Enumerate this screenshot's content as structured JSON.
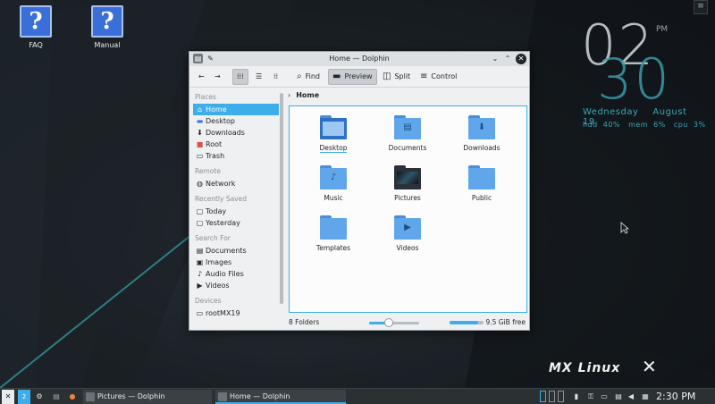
{
  "desktop": {
    "icons": [
      {
        "label": "FAQ",
        "glyph": "?"
      },
      {
        "label": "Manual",
        "glyph": "?"
      }
    ],
    "corner_button_glyph": "≡",
    "clock_widget": {
      "hour": "02",
      "minute": "30",
      "ampm": "PM",
      "day": "Wednesday",
      "date": "August 19",
      "stats": {
        "hdd_label": "hdd",
        "hdd_value": "40%",
        "mem_label": "mem",
        "mem_value": "6%",
        "cpu_label": "cpu",
        "cpu_value": "3%"
      }
    },
    "logo_text": "MX Linux"
  },
  "window": {
    "title": "Home — Dolphin",
    "toolbar": {
      "find": "Find",
      "preview": "Preview",
      "split": "Split",
      "control": "Control"
    },
    "sidebar": {
      "places_title": "Places",
      "places": [
        {
          "label": "Home",
          "icon": "home-icon",
          "selected": true
        },
        {
          "label": "Desktop",
          "icon": "desktop-icon"
        },
        {
          "label": "Downloads",
          "icon": "download-icon"
        },
        {
          "label": "Root",
          "icon": "root-folder-icon"
        },
        {
          "label": "Trash",
          "icon": "trash-icon"
        }
      ],
      "remote_title": "Remote",
      "remote": [
        {
          "label": "Network",
          "icon": "network-icon"
        }
      ],
      "recent_title": "Recently Saved",
      "recent": [
        {
          "label": "Today",
          "icon": "calendar-icon"
        },
        {
          "label": "Yesterday",
          "icon": "calendar-icon"
        }
      ],
      "search_title": "Search For",
      "search": [
        {
          "label": "Documents",
          "icon": "document-icon"
        },
        {
          "label": "Images",
          "icon": "image-icon"
        },
        {
          "label": "Audio Files",
          "icon": "audio-icon"
        },
        {
          "label": "Videos",
          "icon": "video-icon"
        }
      ],
      "devices_title": "Devices",
      "devices": [
        {
          "label": "rootMX19",
          "icon": "drive-icon"
        }
      ]
    },
    "breadcrumb": "Home",
    "folders": [
      {
        "label": "Desktop",
        "icon": "desktop-folder-icon",
        "glyph": ""
      },
      {
        "label": "Documents",
        "icon": "documents-folder-icon",
        "glyph": "▤"
      },
      {
        "label": "Downloads",
        "icon": "downloads-folder-icon",
        "glyph": "⬇"
      },
      {
        "label": "Music",
        "icon": "music-folder-icon",
        "glyph": "♪"
      },
      {
        "label": "Pictures",
        "icon": "pictures-folder-icon",
        "glyph": ""
      },
      {
        "label": "Public",
        "icon": "public-folder-icon",
        "glyph": ""
      },
      {
        "label": "Templates",
        "icon": "templates-folder-icon",
        "glyph": ""
      },
      {
        "label": "Videos",
        "icon": "videos-folder-icon",
        "glyph": "▶"
      }
    ],
    "status": {
      "folder_count": "8 Folders",
      "zoom_level": 0.4,
      "space_used_fraction": 0.85,
      "free_space": "9.5 GiB free"
    }
  },
  "taskbar": {
    "tasks": [
      {
        "label": "Pictures — Dolphin",
        "active": false
      },
      {
        "label": "Home — Dolphin",
        "active": true
      }
    ],
    "workspace_number": "2",
    "time": "2:30 PM"
  },
  "colors": {
    "accent": "#3daee9",
    "folder_blue": "#5fa7ea",
    "clock_teal": "#3a9aaa"
  }
}
